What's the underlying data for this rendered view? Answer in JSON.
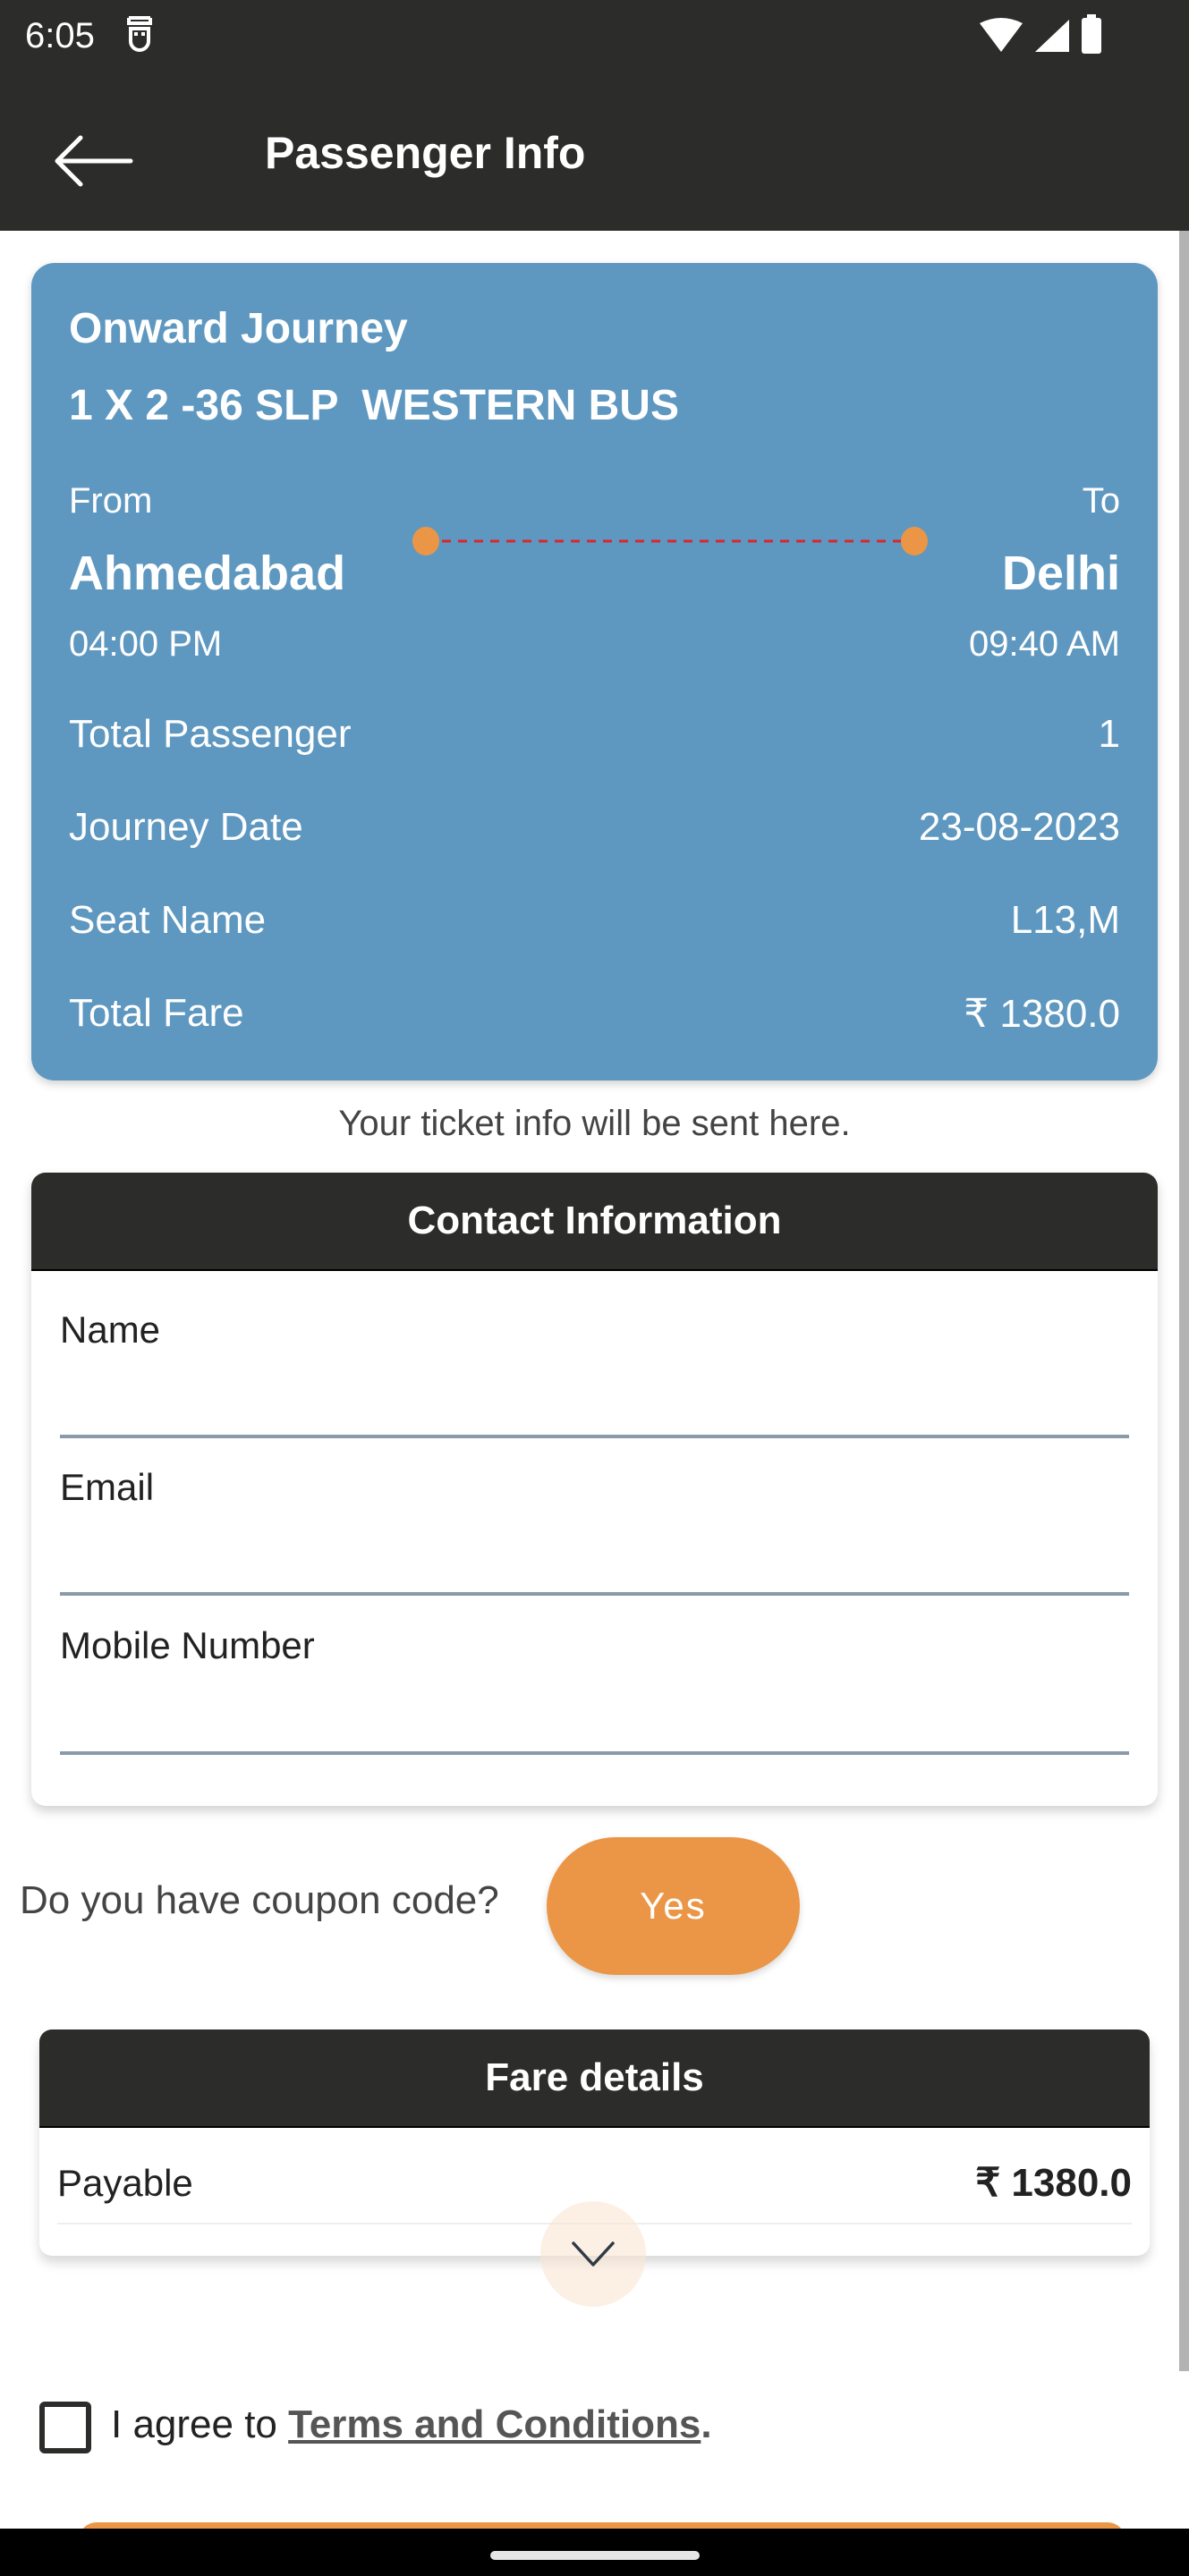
{
  "status_bar": {
    "time": "6:05",
    "icons": [
      "notification-icon",
      "wifi-icon",
      "signal-icon",
      "battery-icon"
    ]
  },
  "app_bar": {
    "title": "Passenger Info",
    "back_icon": "arrow-left-icon"
  },
  "journey": {
    "title": "Onward Journey",
    "bus_name": "1 X 2 -36 SLP  WESTERN BUS",
    "from_label": "From",
    "to_label": "To",
    "from_city": "Ahmedabad",
    "to_city": "Delhi",
    "departure_time": "04:00 PM",
    "arrival_time": "09:40 AM",
    "details": [
      {
        "label": "Total Passenger",
        "value": "1"
      },
      {
        "label": "Journey Date",
        "value": "23-08-2023"
      },
      {
        "label": "Seat Name",
        "value": "L13,M"
      },
      {
        "label": "Total Fare",
        "value": "₹ 1380.0"
      }
    ],
    "card_color": "#5e98c0",
    "route_dot_color": "#eb9646",
    "route_line_color": "#d9262c"
  },
  "ticket_info_note": "Your ticket info will be sent here.",
  "contact": {
    "header": "Contact Information",
    "fields": [
      {
        "label": "Name",
        "value": "",
        "placeholder": ""
      },
      {
        "label": "Email",
        "value": "",
        "placeholder": ""
      },
      {
        "label": "Mobile Number",
        "value": "",
        "placeholder": ""
      }
    ]
  },
  "coupon": {
    "question": "Do you have coupon code?",
    "button_label": "Yes",
    "accent": "#eb9646"
  },
  "fare": {
    "header": "Fare details",
    "payable_label": "Payable",
    "payable_value": "₹ 1380.0",
    "expand_icon": "chevron-down-icon"
  },
  "terms": {
    "checked": false,
    "prefix": "I agree to ",
    "link_text": "Terms and Conditions",
    "suffix": "."
  }
}
